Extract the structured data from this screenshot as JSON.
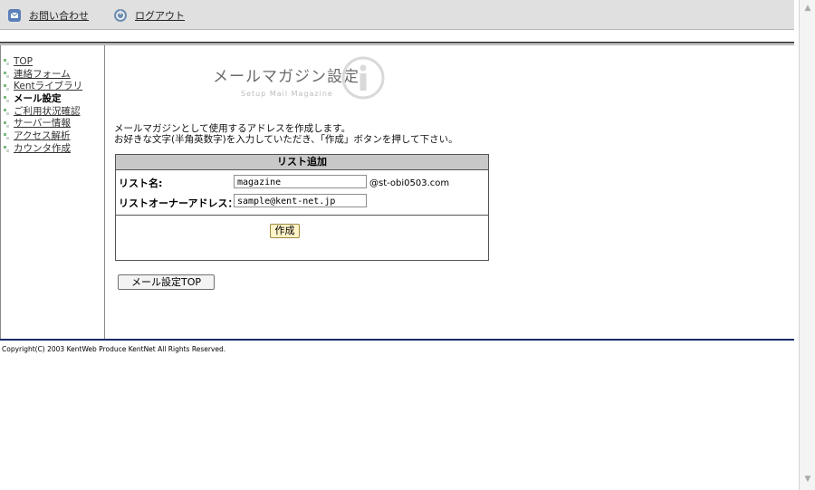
{
  "toolbar": {
    "contact_label": "お問い合わせ",
    "logout_label": "ログアウト"
  },
  "sidebar": {
    "items": [
      {
        "label": "TOP"
      },
      {
        "label": "連絡フォーム"
      },
      {
        "label": "Kentライブラリ"
      },
      {
        "label": "メール設定"
      },
      {
        "label": "ご利用状況確認"
      },
      {
        "label": "サーバー情報"
      },
      {
        "label": "アクセス解析"
      },
      {
        "label": "カウンタ作成"
      }
    ]
  },
  "main": {
    "title": "メールマガジン設定",
    "subtitle": "Setup Mail Magazine",
    "intro_line1": "メールマガジンとして使用するアドレスを作成します。",
    "intro_line2": "お好きな文字(半角英数字)を入力していただき、「作成」ボタンを押して下さい。",
    "form": {
      "heading": "リスト追加",
      "list_name_label": "リスト名:",
      "list_name_value": "magazine",
      "domain_suffix": "@st-obi0503.com",
      "owner_label": "リストオーナーアドレス：",
      "owner_value": "sample@kent-net.jp",
      "create_label": "作成"
    },
    "back_button": "メール設定TOP"
  },
  "footer": {
    "copyright": "Copyright(C) 2003 KentWeb Produce KentNet All Rights Reserved."
  }
}
